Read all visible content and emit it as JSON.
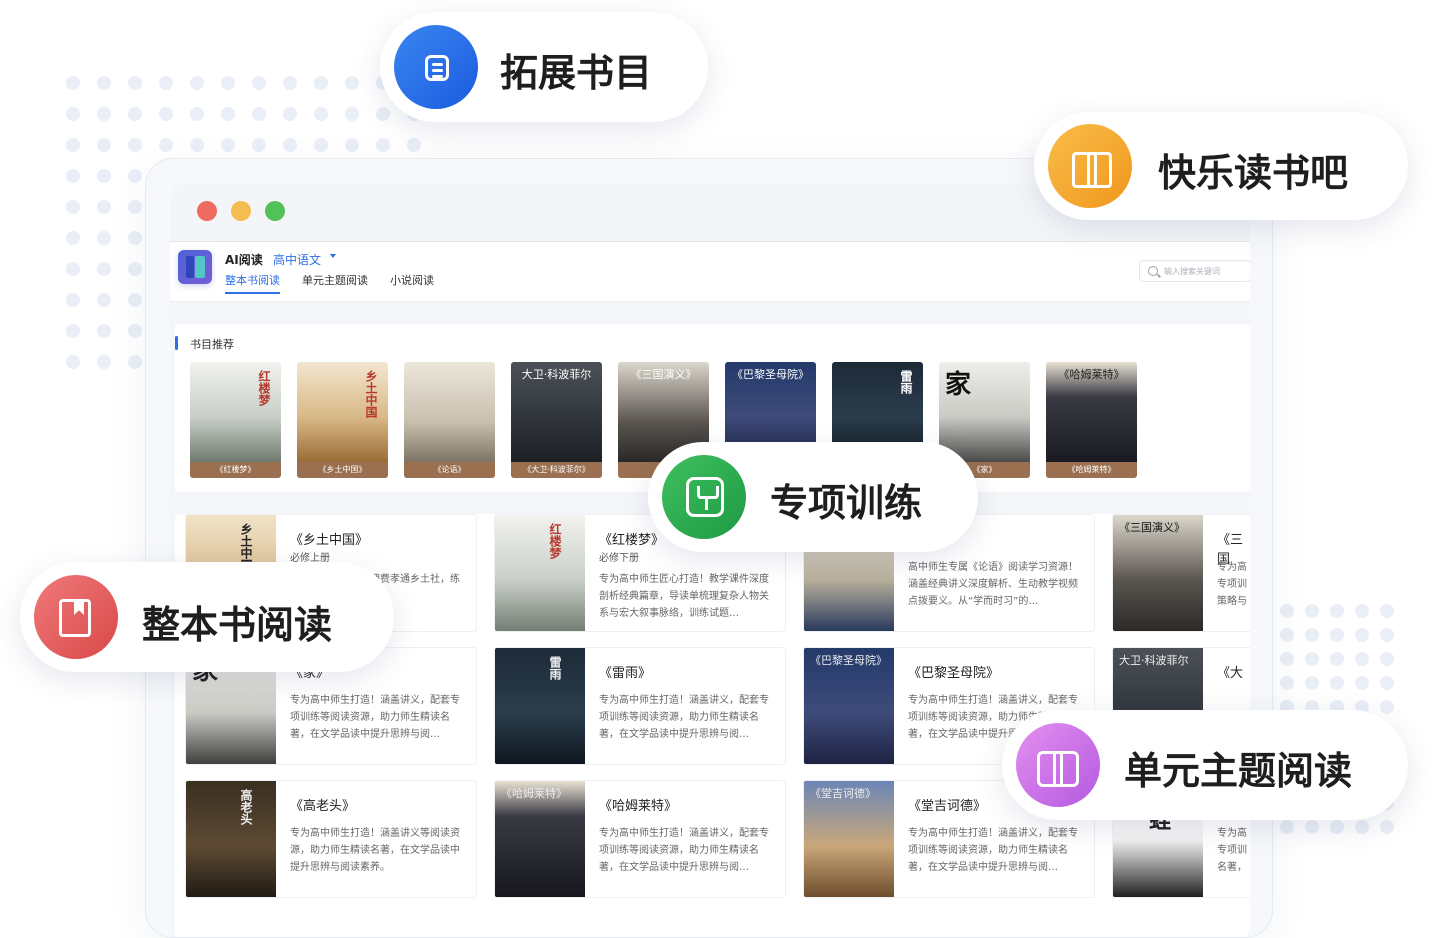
{
  "badges": {
    "extended": "拓展书目",
    "happy": "快乐读书吧",
    "special": "专项训练",
    "whole": "整本书阅读",
    "unit": "单元主题阅读"
  },
  "app": {
    "name": "AI阅读",
    "subject": "高中语文",
    "tabs": [
      "整本书阅读",
      "单元主题阅读",
      "小说阅读"
    ],
    "search_placeholder": "输入搜索关键词"
  },
  "recommend": {
    "title": "书目推荐",
    "books": [
      {
        "caption": "《红楼梦》",
        "cover_text": "红楼梦"
      },
      {
        "caption": "《乡土中国》",
        "cover_text": "乡土中国"
      },
      {
        "caption": "《论语》",
        "cover_text": ""
      },
      {
        "caption": "《大卫·科波菲尔》",
        "cover_text": "大卫·科波菲尔"
      },
      {
        "caption": "《三国",
        "cover_text": "《三国演义》"
      },
      {
        "caption": "",
        "cover_text": "《巴黎圣母院》"
      },
      {
        "caption": "",
        "cover_text": "雷雨"
      },
      {
        "caption": "《家》",
        "cover_text": "家"
      },
      {
        "caption": "《哈姆莱特》",
        "cover_text": "《哈姆莱特》"
      }
    ]
  },
  "cards": [
    {
      "title": "《乡土中国》",
      "sub": "必修上册",
      "desc": "含教学课件拆解，理费孝通乡土社，练试题强化考…",
      "cover_text": "乡土中国"
    },
    {
      "title": "《红楼梦》",
      "sub": "必修下册",
      "desc": "专为高中师生匠心打造！教学课件深度剖析经典篇章，导读单梳理复杂人物关系与宏大叙事脉络，训练试题…",
      "cover_text": "红楼梦"
    },
    {
      "title": "语》",
      "sub": "",
      "desc": "高中师生专属《论语》阅读学习资源！涵盖经典讲义深度解析、生动教学视频点拨要义。从“学而时习”的…",
      "cover_text": "论语"
    },
    {
      "title": "《三国",
      "sub": "",
      "desc": "专为高专项训策略与",
      "cover_text": "《三国演义》"
    },
    {
      "title": "《家》",
      "sub": "",
      "desc": "专为高中师生打造！涵盖讲义，配套专项训练等阅读资源，助力师生精读名著，在文学品读中提升思辨与阅…",
      "cover_text": "家"
    },
    {
      "title": "《雷雨》",
      "sub": "",
      "desc": "专为高中师生打造！涵盖讲义，配套专项训练等阅读资源，助力师生精读名著，在文学品读中提升思辨与阅…",
      "cover_text": "雷雨"
    },
    {
      "title": "《巴黎圣母院》",
      "sub": "",
      "desc": "专为高中师生打造！涵盖讲义，配套专项训练等阅读资源，助力师生精读名著，在文学品读中提升思辨与阅…",
      "cover_text": "《巴黎圣母院》"
    },
    {
      "title": "《大",
      "sub": "",
      "desc": "",
      "cover_text": "大卫·科波菲尔"
    },
    {
      "title": "《高老头》",
      "sub": "",
      "desc": "专为高中师生打造！涵盖讲义等阅读资源，助力师生精读名著，在文学品读中提升思辨与阅读素养。",
      "cover_text": "高老头"
    },
    {
      "title": "《哈姆莱特》",
      "sub": "",
      "desc": "专为高中师生打造！涵盖讲义，配套专项训练等阅读资源，助力师生精读名著，在文学品读中提升思辨与阅…",
      "cover_text": "《哈姆莱特》"
    },
    {
      "title": "《堂吉诃德》",
      "sub": "",
      "desc": "专为高中师生打造！涵盖讲义，配套专项训练等阅读资源，助力师生精读名著，在文学品读中提升思辨与阅…",
      "cover_text": "《堂吉诃德》"
    },
    {
      "title": "",
      "sub": "",
      "desc": "专为高专项训名著，",
      "cover_text": "蛙"
    }
  ],
  "colors": {
    "accent": "#2f6fe4",
    "light_red": "#ef6a5f",
    "light_yellow": "#f5bd4f",
    "light_green": "#52c15a"
  }
}
